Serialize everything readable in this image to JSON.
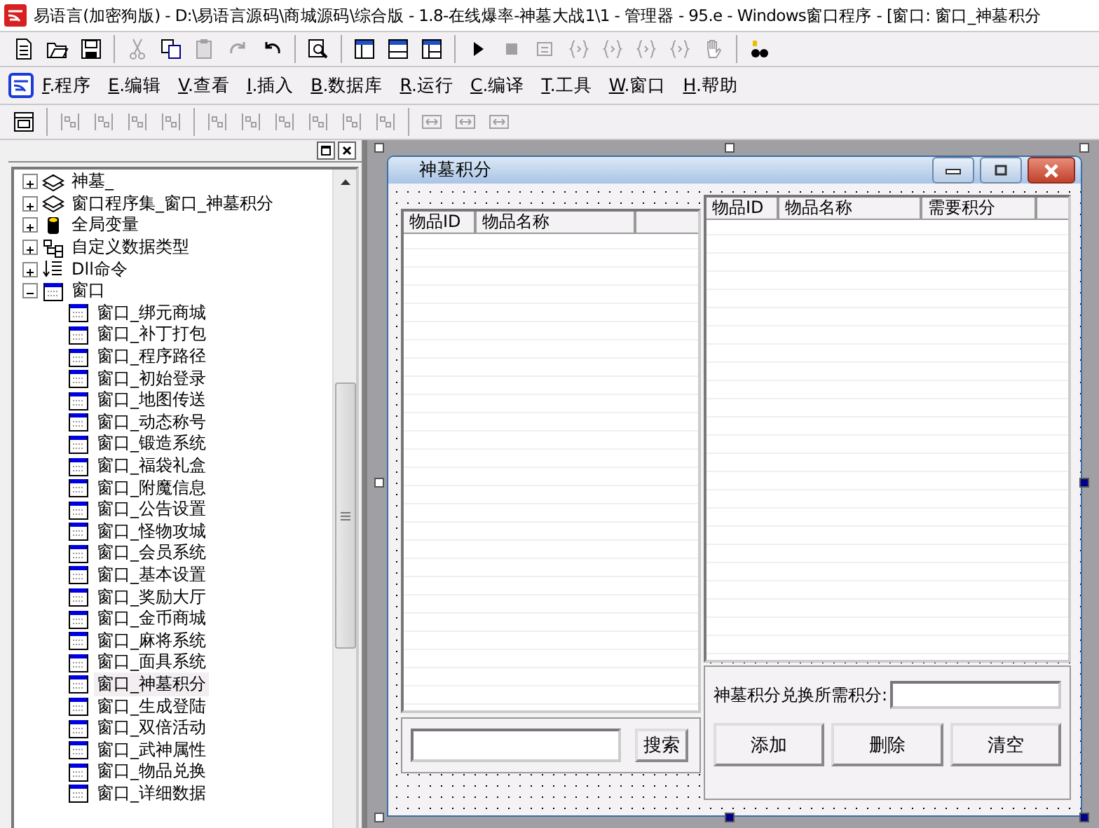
{
  "window": {
    "title": "易语言(加密狗版) - D:\\易语言源码\\商城源码\\综合版 - 1.8-在线爆率-神墓大战1\\1 - 管理器 - 95.e - Windows窗口程序 - [窗口: 窗口_神墓积分"
  },
  "toolbar": [
    {
      "kind": "new",
      "disabled": false
    },
    {
      "kind": "open",
      "disabled": false
    },
    {
      "kind": "save",
      "disabled": false
    },
    {
      "kind": "sep"
    },
    {
      "kind": "cut",
      "disabled": true
    },
    {
      "kind": "copy",
      "disabled": false
    },
    {
      "kind": "paste",
      "disabled": true
    },
    {
      "kind": "redo",
      "disabled": true
    },
    {
      "kind": "undo",
      "disabled": false
    },
    {
      "kind": "sep"
    },
    {
      "kind": "preview",
      "disabled": false
    },
    {
      "kind": "sep"
    },
    {
      "kind": "layout-a",
      "disabled": false
    },
    {
      "kind": "layout-b",
      "disabled": false
    },
    {
      "kind": "layout-c",
      "disabled": false
    },
    {
      "kind": "sep"
    },
    {
      "kind": "run",
      "disabled": false
    },
    {
      "kind": "stop",
      "disabled": true
    },
    {
      "kind": "step",
      "disabled": true
    },
    {
      "kind": "brace",
      "disabled": true
    },
    {
      "kind": "brace",
      "disabled": true
    },
    {
      "kind": "brace",
      "disabled": true
    },
    {
      "kind": "brace",
      "disabled": true
    },
    {
      "kind": "hand",
      "disabled": true
    },
    {
      "kind": "sep"
    },
    {
      "kind": "help",
      "disabled": false
    }
  ],
  "menu": [
    "F.程序",
    "E.编辑",
    "V.查看",
    "I.插入",
    "B.数据库",
    "R.运行",
    "C.编译",
    "T.工具",
    "W.窗口",
    "H.帮助"
  ],
  "align_toolbar": [
    {
      "kind": "form",
      "disabled": false
    },
    {
      "kind": "sep"
    },
    {
      "kind": "align",
      "disabled": true
    },
    {
      "kind": "align",
      "disabled": true
    },
    {
      "kind": "align",
      "disabled": true
    },
    {
      "kind": "align",
      "disabled": true
    },
    {
      "kind": "sep"
    },
    {
      "kind": "align",
      "disabled": true
    },
    {
      "kind": "align",
      "disabled": true
    },
    {
      "kind": "align",
      "disabled": true
    },
    {
      "kind": "align",
      "disabled": true
    },
    {
      "kind": "align",
      "disabled": true
    },
    {
      "kind": "align",
      "disabled": true
    },
    {
      "kind": "sep"
    },
    {
      "kind": "size",
      "disabled": true
    },
    {
      "kind": "size",
      "disabled": true
    },
    {
      "kind": "size",
      "disabled": true
    }
  ],
  "tree": [
    {
      "label": "神墓_",
      "kind": "module",
      "expanded": false
    },
    {
      "label": "窗口程序集_窗口_神墓积分",
      "kind": "module",
      "expanded": false
    },
    {
      "label": "全局变量",
      "kind": "var",
      "expanded": false
    },
    {
      "label": "自定义数据类型",
      "kind": "type",
      "expanded": false
    },
    {
      "label": "Dll命令",
      "kind": "dll",
      "expanded": false
    },
    {
      "label": "窗口",
      "kind": "window",
      "expanded": true,
      "children": [
        {
          "label": "窗口_绑元商城",
          "selected": false
        },
        {
          "label": "窗口_补丁打包",
          "selected": false
        },
        {
          "label": "窗口_程序路径",
          "selected": false
        },
        {
          "label": "窗口_初始登录",
          "selected": false
        },
        {
          "label": "窗口_地图传送",
          "selected": false
        },
        {
          "label": "窗口_动态称号",
          "selected": false
        },
        {
          "label": "窗口_锻造系统",
          "selected": false
        },
        {
          "label": "窗口_福袋礼盒",
          "selected": false
        },
        {
          "label": "窗口_附魔信息",
          "selected": false
        },
        {
          "label": "窗口_公告设置",
          "selected": false
        },
        {
          "label": "窗口_怪物攻城",
          "selected": false
        },
        {
          "label": "窗口_会员系统",
          "selected": false
        },
        {
          "label": "窗口_基本设置",
          "selected": false
        },
        {
          "label": "窗口_奖励大厅",
          "selected": false
        },
        {
          "label": "窗口_金币商城",
          "selected": false
        },
        {
          "label": "窗口_麻将系统",
          "selected": false
        },
        {
          "label": "窗口_面具系统",
          "selected": false
        },
        {
          "label": "窗口_神墓积分",
          "selected": true
        },
        {
          "label": "窗口_生成登陆",
          "selected": false
        },
        {
          "label": "窗口_双倍活动",
          "selected": false
        },
        {
          "label": "窗口_武神属性",
          "selected": false
        },
        {
          "label": "窗口_物品兑换",
          "selected": false
        },
        {
          "label": "窗口_详细数据",
          "selected": false
        }
      ]
    }
  ],
  "form": {
    "title": "神墓积分",
    "left_table": {
      "columns": [
        "物品ID",
        "物品名称"
      ]
    },
    "search_button": "搜索",
    "right_table": {
      "columns": [
        "物品ID",
        "物品名称",
        "需要积分"
      ]
    },
    "cost_label": "神墓积分兑换所需积分:",
    "buttons": [
      "添加",
      "删除",
      "清空"
    ]
  }
}
